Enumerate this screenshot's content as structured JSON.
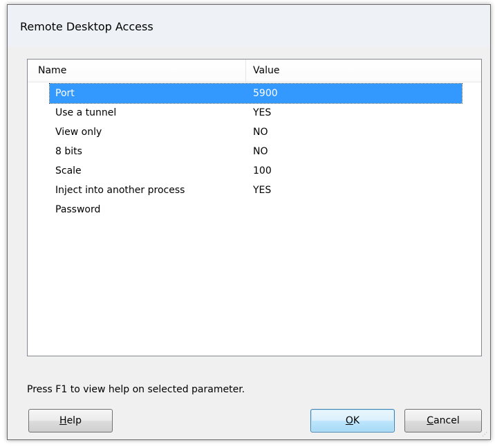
{
  "window": {
    "title": "Remote Desktop Access"
  },
  "list": {
    "columns": {
      "name": "Name",
      "value": "Value"
    },
    "rows": [
      {
        "name": "Port",
        "value": "5900",
        "selected": true
      },
      {
        "name": "Use a tunnel",
        "value": "YES"
      },
      {
        "name": "View only",
        "value": "NO"
      },
      {
        "name": "8 bits",
        "value": "NO"
      },
      {
        "name": "Scale",
        "value": "100"
      },
      {
        "name": "Inject into another process",
        "value": "YES"
      },
      {
        "name": "Password",
        "value": ""
      }
    ]
  },
  "help_text": "Press F1 to view help on selected parameter.",
  "buttons": {
    "help": {
      "mnemonic": "H",
      "rest": "elp"
    },
    "ok": {
      "mnemonic": "O",
      "rest": "K"
    },
    "cancel": {
      "mnemonic": "C",
      "rest": "ancel"
    }
  },
  "colors": {
    "selection": "#3399ff",
    "dialog_bg": "#f0f0f0"
  }
}
